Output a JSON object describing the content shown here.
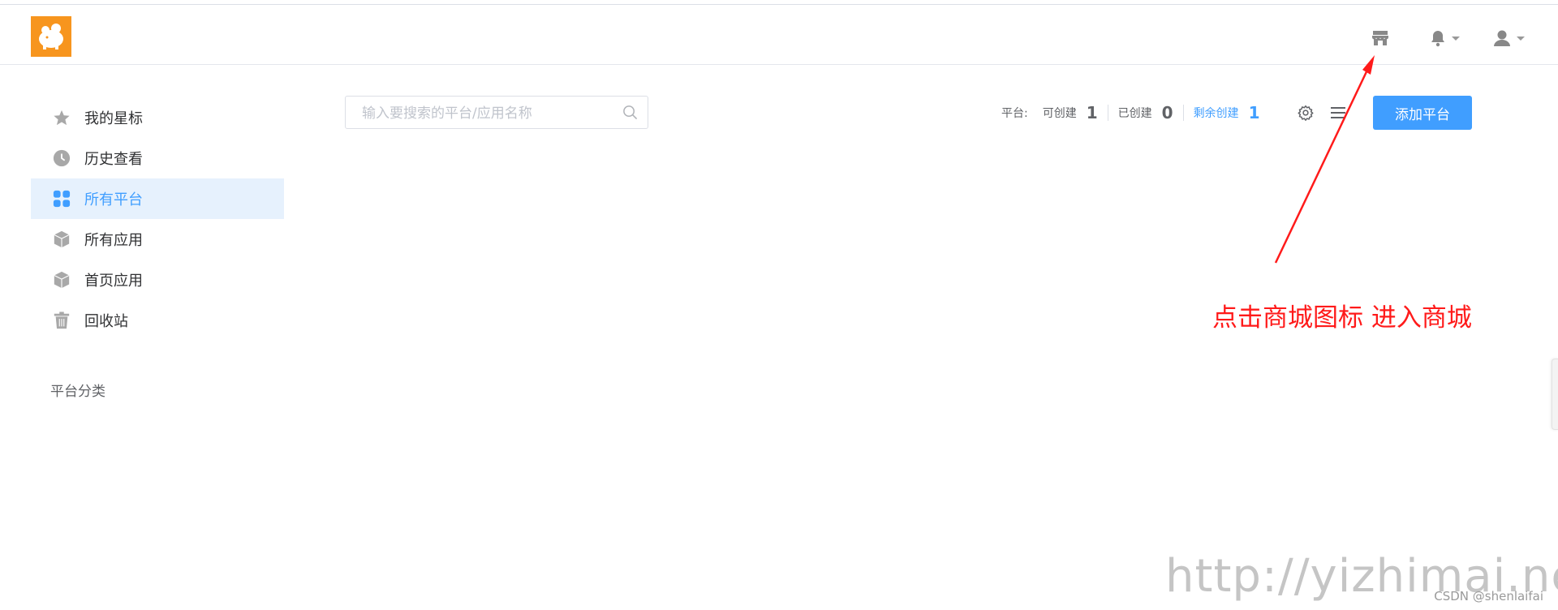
{
  "header": {
    "icons": [
      "store-icon",
      "bell-icon",
      "user-icon"
    ]
  },
  "sidebar": {
    "items": [
      {
        "label": "我的星标",
        "icon": "star-icon"
      },
      {
        "label": "历史查看",
        "icon": "clock-icon"
      },
      {
        "label": "所有平台",
        "icon": "grid-icon",
        "active": true
      },
      {
        "label": "所有应用",
        "icon": "cube-icon"
      },
      {
        "label": "首页应用",
        "icon": "cube-icon"
      },
      {
        "label": "回收站",
        "icon": "trash-icon"
      }
    ],
    "section_title": "平台分类"
  },
  "search": {
    "placeholder": "输入要搜索的平台/应用名称"
  },
  "stats": {
    "prefix": "平台:",
    "can_create_label": "可创建",
    "can_create_value": "1",
    "created_label": "已创建",
    "created_value": "0",
    "remaining_label": "剩余创建",
    "remaining_value": "1"
  },
  "toolbar": {
    "add_button_label": "添加平台"
  },
  "annotation": {
    "text": "点击商城图标 进入商城",
    "color": "#ff1a1a"
  },
  "watermark": {
    "url": "http://yizhimai.net/",
    "credit": "CSDN @shenlaifai"
  },
  "colors": {
    "accent": "#409eff",
    "logo_bg": "#f7951e",
    "active_bg": "#e6f1fd"
  }
}
